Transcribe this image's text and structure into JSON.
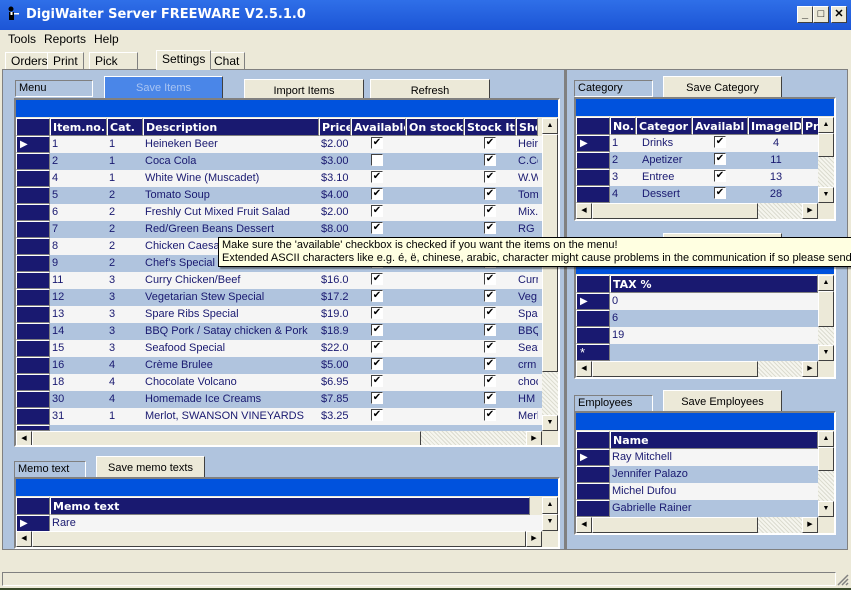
{
  "window": {
    "title": "DigiWaiter Server FREEWARE V2.5.1.0",
    "controls": {
      "minimize": "_",
      "maximize": "□",
      "close": "✕"
    }
  },
  "menubar": [
    "Tools",
    "Reports",
    "Help"
  ],
  "tabs": [
    {
      "label": "Orders"
    },
    {
      "label": "Print"
    },
    {
      "label": "Pick Orders"
    },
    {
      "label": "Settings",
      "active": true
    },
    {
      "label": "Chat"
    }
  ],
  "menu_section": {
    "label": "Menu",
    "buttons": {
      "save": "Save Items",
      "import": "Import Items",
      "refresh": "Refresh"
    },
    "columns": [
      "Item.no.",
      "Cat.",
      "Description",
      "Price",
      "Available",
      "On stock",
      "Stock Ite",
      "Sho"
    ],
    "rows": [
      {
        "no": "1",
        "cat": "1",
        "desc": "Heineken Beer",
        "price": "$2.00",
        "available": true,
        "stock_item": true,
        "short": "Hein",
        "current": true
      },
      {
        "no": "2",
        "cat": "1",
        "desc": "Coca Cola",
        "price": "$3.00",
        "available": false,
        "stock_item": true,
        "short": "C.Co"
      },
      {
        "no": "4",
        "cat": "1",
        "desc": "White Wine (Muscadet)",
        "price": "$3.10",
        "available": true,
        "stock_item": true,
        "short": "W.W"
      },
      {
        "no": "5",
        "cat": "2",
        "desc": "Tomato Soup",
        "price": "$4.00",
        "available": true,
        "stock_item": true,
        "short": "Tom"
      },
      {
        "no": "6",
        "cat": "2",
        "desc": "Freshly Cut Mixed Fruit Salad",
        "price": "$2.00",
        "available": true,
        "stock_item": true,
        "short": "Mix.f"
      },
      {
        "no": "7",
        "cat": "2",
        "desc": "Red/Green Beans Dessert",
        "price": "$8.00",
        "available": true,
        "stock_item": true,
        "short": "RG B"
      },
      {
        "no": "8",
        "cat": "2",
        "desc": "Chicken Caesar",
        "price": "",
        "available": true,
        "stock_item": true,
        "short": ""
      },
      {
        "no": "9",
        "cat": "2",
        "desc": "Chef's Special Salad",
        "price": "",
        "available": true,
        "stock_item": true,
        "short": ""
      },
      {
        "no": "11",
        "cat": "3",
        "desc": "Curry Chicken/Beef",
        "price": "$16.0",
        "available": true,
        "stock_item": true,
        "short": "Curr"
      },
      {
        "no": "12",
        "cat": "3",
        "desc": "Vegetarian Stew Special",
        "price": "$17.2",
        "available": true,
        "stock_item": true,
        "short": "Veg"
      },
      {
        "no": "13",
        "cat": "3",
        "desc": "Spare Ribs Special",
        "price": "$19.0",
        "available": true,
        "stock_item": true,
        "short": "Spar"
      },
      {
        "no": "14",
        "cat": "3",
        "desc": "BBQ Pork / Satay chicken & Pork",
        "price": "$18.9",
        "available": true,
        "stock_item": true,
        "short": "BBQ"
      },
      {
        "no": "15",
        "cat": "3",
        "desc": "Seafood Special",
        "price": "$22.0",
        "available": true,
        "stock_item": true,
        "short": "Seaf"
      },
      {
        "no": "16",
        "cat": "4",
        "desc": "Crème Brulee",
        "price": "$5.00",
        "available": true,
        "stock_item": true,
        "short": "crm"
      },
      {
        "no": "18",
        "cat": "4",
        "desc": "Chocolate Volcano",
        "price": "$6.95",
        "available": true,
        "stock_item": true,
        "short": "choc"
      },
      {
        "no": "30",
        "cat": "4",
        "desc": "Homemade Ice Creams",
        "price": "$7.85",
        "available": true,
        "stock_item": true,
        "short": "HM I"
      },
      {
        "no": "31",
        "cat": "1",
        "desc": "Merlot, SWANSON VINEYARDS",
        "price": "$3.25",
        "available": true,
        "stock_item": true,
        "short": "Merl"
      }
    ]
  },
  "tooltip": {
    "line1": "Make sure the 'available' checkbox is checked if you want the items on the menu!",
    "line2": "Extended ASCII characters like e.g. é, ë, chinese, arabic, character might cause problems in the communication if so please send an"
  },
  "memo_section": {
    "label": "Memo text",
    "save": "Save memo texts",
    "columns": [
      "Memo text"
    ],
    "rows": [
      {
        "text": "Rare",
        "current": true
      }
    ]
  },
  "category_section": {
    "label": "Category",
    "save": "Save Category",
    "columns": [
      "No.",
      "Categor",
      "Availabl",
      "ImageID",
      "Prir"
    ],
    "rows": [
      {
        "no": "1",
        "name": "Drinks",
        "available": true,
        "image": "4",
        "current": true
      },
      {
        "no": "2",
        "name": "Apetizer",
        "available": true,
        "image": "11"
      },
      {
        "no": "3",
        "name": "Entree",
        "available": true,
        "image": "13"
      },
      {
        "no": "4",
        "name": "Dessert",
        "available": true,
        "image": "28"
      }
    ]
  },
  "tax_section": {
    "columns": [
      "TAX %"
    ],
    "rows": [
      {
        "v": "0",
        "current": true
      },
      {
        "v": "6"
      },
      {
        "v": "19"
      }
    ],
    "new_row_marker": "*"
  },
  "employees_section": {
    "label": "Employees",
    "save": "Save Employees",
    "columns": [
      "Name"
    ],
    "rows": [
      {
        "name": "Ray Mitchell",
        "current": true
      },
      {
        "name": "Jennifer Palazo"
      },
      {
        "name": "Michel Dufou"
      },
      {
        "name": "Gabrielle Rainer"
      }
    ]
  }
}
